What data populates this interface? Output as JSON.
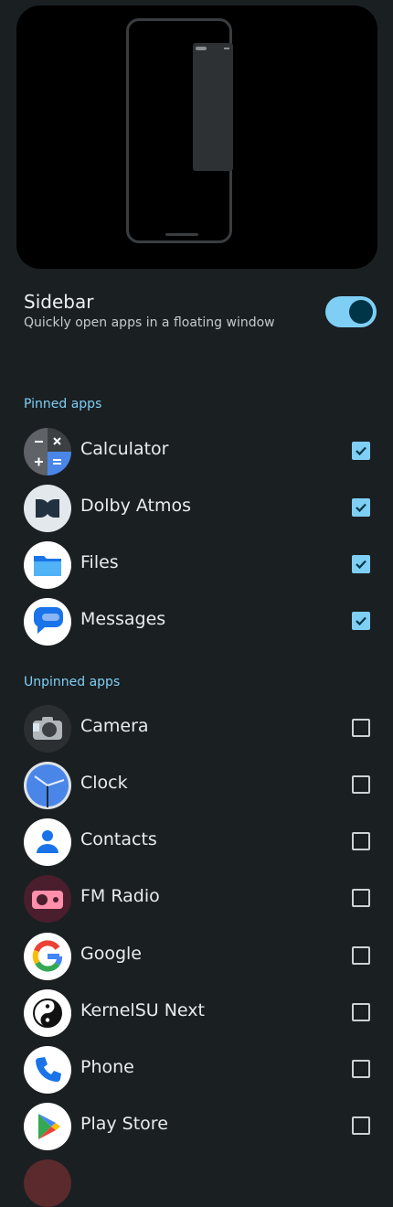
{
  "sidebar": {
    "title": "Sidebar",
    "subtitle": "Quickly open apps in a floating window",
    "enabled": true
  },
  "sections": {
    "pinned": "Pinned apps",
    "unpinned": "Unpinned apps"
  },
  "pinned_apps": [
    {
      "label": "Calculator",
      "icon": "calculator-icon",
      "checked": true
    },
    {
      "label": "Dolby Atmos",
      "icon": "dolby-icon",
      "checked": true
    },
    {
      "label": "Files",
      "icon": "files-icon",
      "checked": true
    },
    {
      "label": "Messages",
      "icon": "messages-icon",
      "checked": true
    }
  ],
  "unpinned_apps": [
    {
      "label": "Camera",
      "icon": "camera-icon",
      "checked": false
    },
    {
      "label": "Clock",
      "icon": "clock-icon",
      "checked": false
    },
    {
      "label": "Contacts",
      "icon": "contacts-icon",
      "checked": false
    },
    {
      "label": "FM Radio",
      "icon": "radio-icon",
      "checked": false
    },
    {
      "label": "Google",
      "icon": "google-icon",
      "checked": false
    },
    {
      "label": "KernelSU Next",
      "icon": "kernelsu-icon",
      "checked": false
    },
    {
      "label": "Phone",
      "icon": "phone-icon",
      "checked": false
    },
    {
      "label": "Play Store",
      "icon": "play-store-icon",
      "checked": false
    }
  ],
  "colors": {
    "accent": "#7fcff5",
    "background": "#1a1f22"
  }
}
